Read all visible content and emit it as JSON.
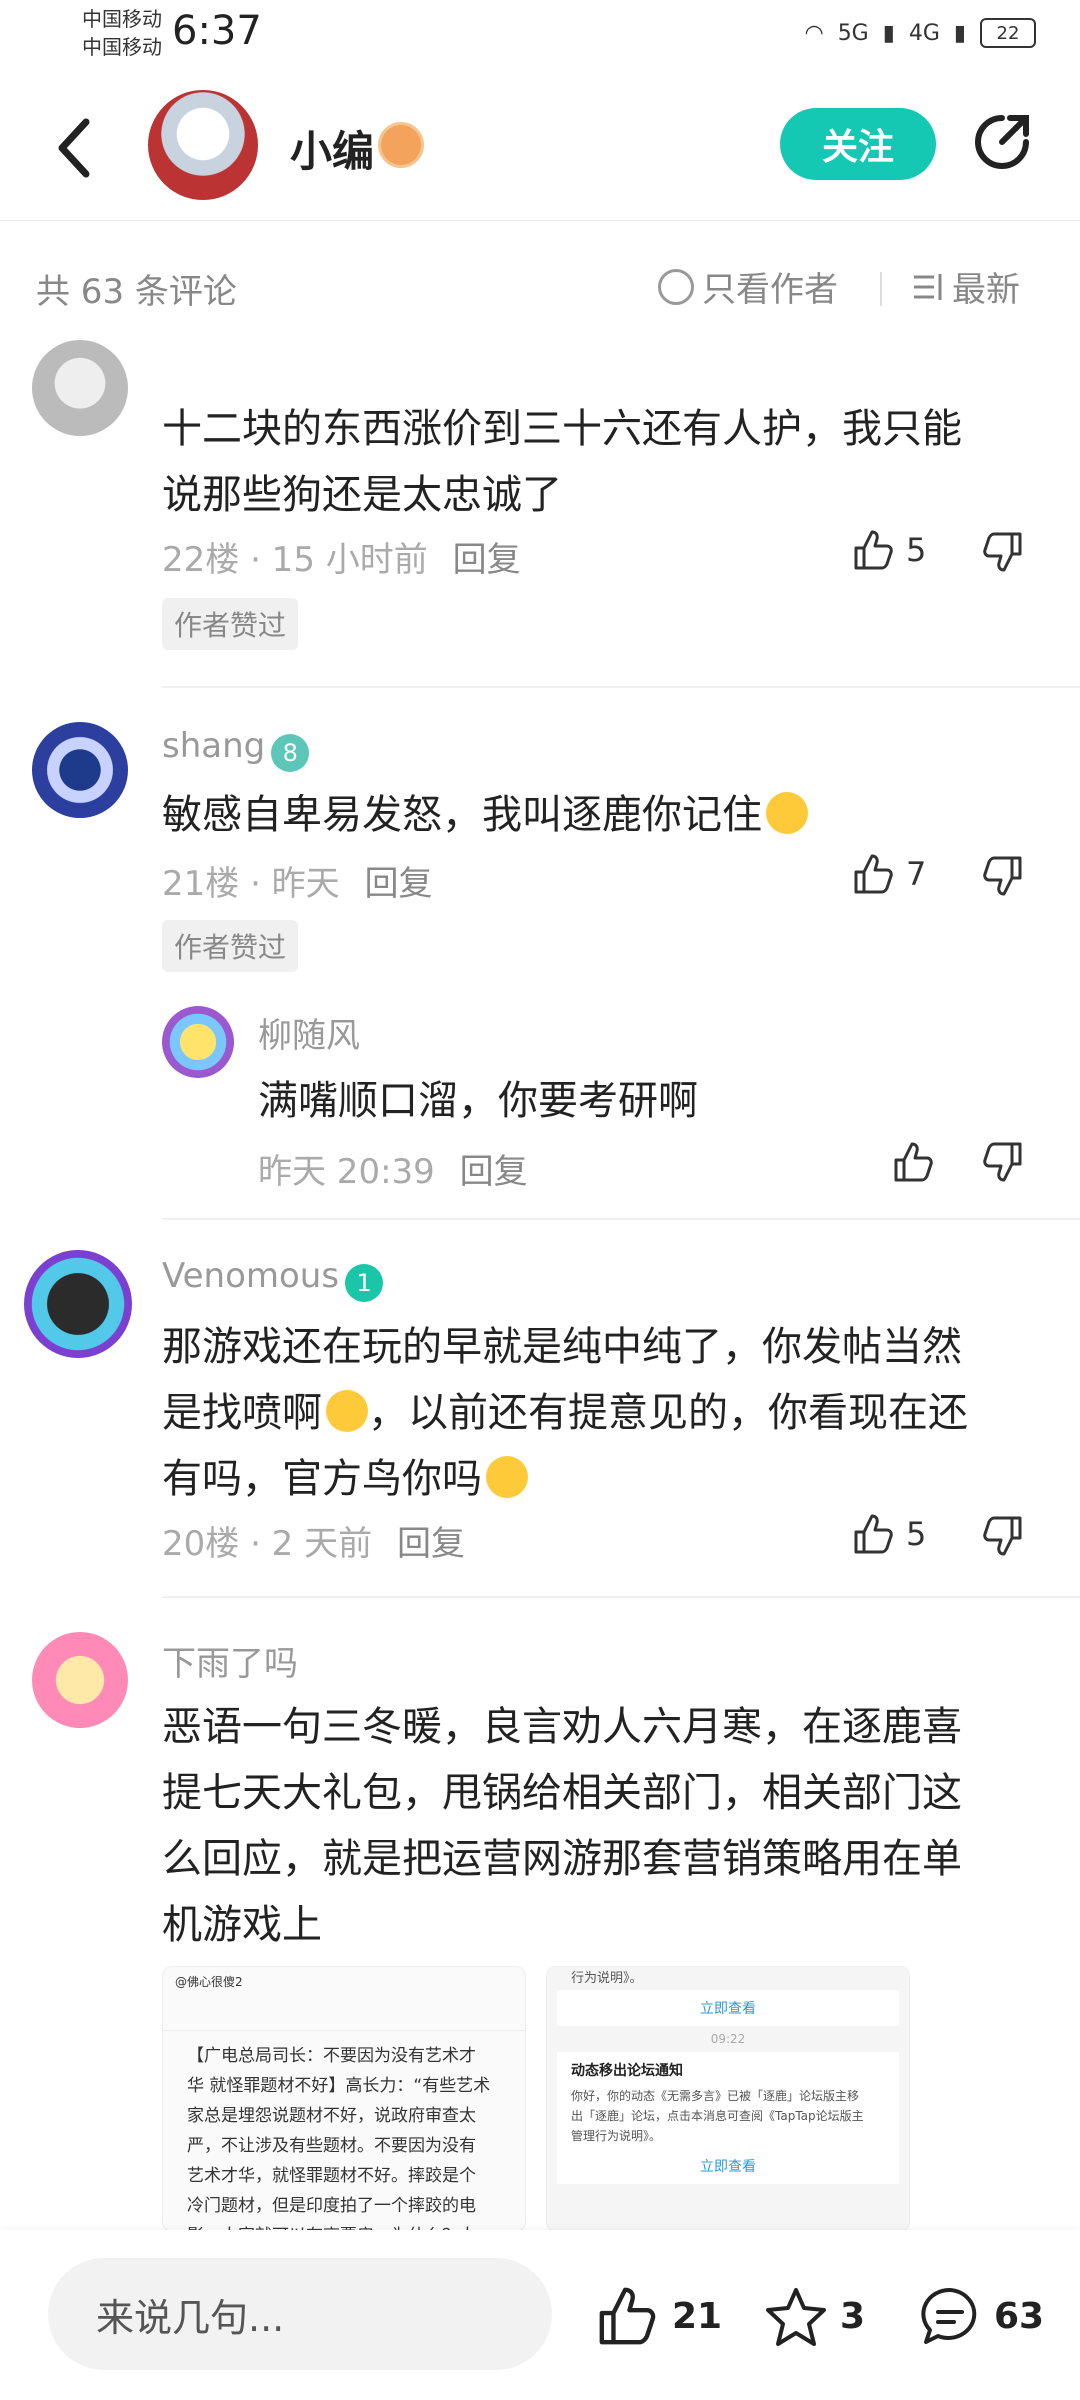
{
  "status_bar": {
    "carrier_1": "中国移动",
    "carrier_2": "中国移动",
    "time": "6:37",
    "signal_1": "5G",
    "signal_2": "4G",
    "battery": "22"
  },
  "header": {
    "username": "小编",
    "follow_label": "关注"
  },
  "filter": {
    "count_label": "共 63 条评论",
    "only_author": "只看作者",
    "sort_label": "最新"
  },
  "comments": [
    {
      "username": "",
      "text_line1": "十二块的东西涨价到三十六还有人护，我只能",
      "text_line2": "说那些狗还是太忠诚了",
      "meta": "22楼 · 15 小时前",
      "reply": "回复",
      "tag": "作者赞过",
      "likes": "5"
    },
    {
      "username": "shang",
      "level": "8",
      "text": "敏感自卑易发怒，我叫逐鹿你记住",
      "meta": "21楼 · 昨天",
      "reply": "回复",
      "tag": "作者赞过",
      "likes": "7",
      "sub_reply": {
        "username": "柳随风",
        "text": "满嘴顺口溜，你要考研啊",
        "meta": "昨天 20:39",
        "reply": "回复"
      }
    },
    {
      "username": "Venomous",
      "level": "1",
      "text_line1": "那游戏还在玩的早就是纯中纯了，你发帖当然",
      "text_line2": "是找喷啊",
      "text_line2b": "，以前还有提意见的，你看现在还",
      "text_line3": "有吗，官方鸟你吗",
      "meta": "20楼 · 2 天前",
      "reply": "回复",
      "likes": "5"
    },
    {
      "username": "下雨了吗",
      "text_line1": "恶语一句三冬暖，良言劝人六月寒，在逐鹿喜",
      "text_line2": "提七天大礼包，甩锅给相关部门，相关部门这",
      "text_line3": "么回应，就是把运营网游那套营销策略用在单",
      "text_line4": "机游戏上",
      "image1": {
        "header": "@佛心很傻2",
        "line1": "【广电总局司长：不要因为没有艺术才",
        "line2": "华 就怪罪题材不好】高长力：“有些艺术",
        "line3": "家总是埋怨说题材不好，说政府审查太",
        "line4": "严，不让涉及有些题材。不要因为没有",
        "line5": "艺术才华，就怪罪题材不好。摔跤是个",
        "line6": "冷门题材，但是印度拍了一个摔跤的电",
        "line7": "影，人家就可以有高票房，为什么？人"
      },
      "image2": {
        "top": "行为说明》。",
        "link1": "立即查看",
        "time": "09:22",
        "title": "动态移出论坛通知",
        "body1": "你好，你的动态《无需多言》已被「逐鹿」论坛版主移",
        "body2": "出「逐鹿」论坛，点击本消息可查阅《TapTap论坛版主",
        "body3": "管理行为说明》。",
        "link2": "立即查看"
      }
    }
  ],
  "bottom_bar": {
    "input_placeholder": "来说几句...",
    "likes": "21",
    "favorites": "3",
    "comments": "63"
  },
  "colors": {
    "accent": "#14c8b3",
    "text_primary": "#222222",
    "text_secondary": "#999999"
  }
}
